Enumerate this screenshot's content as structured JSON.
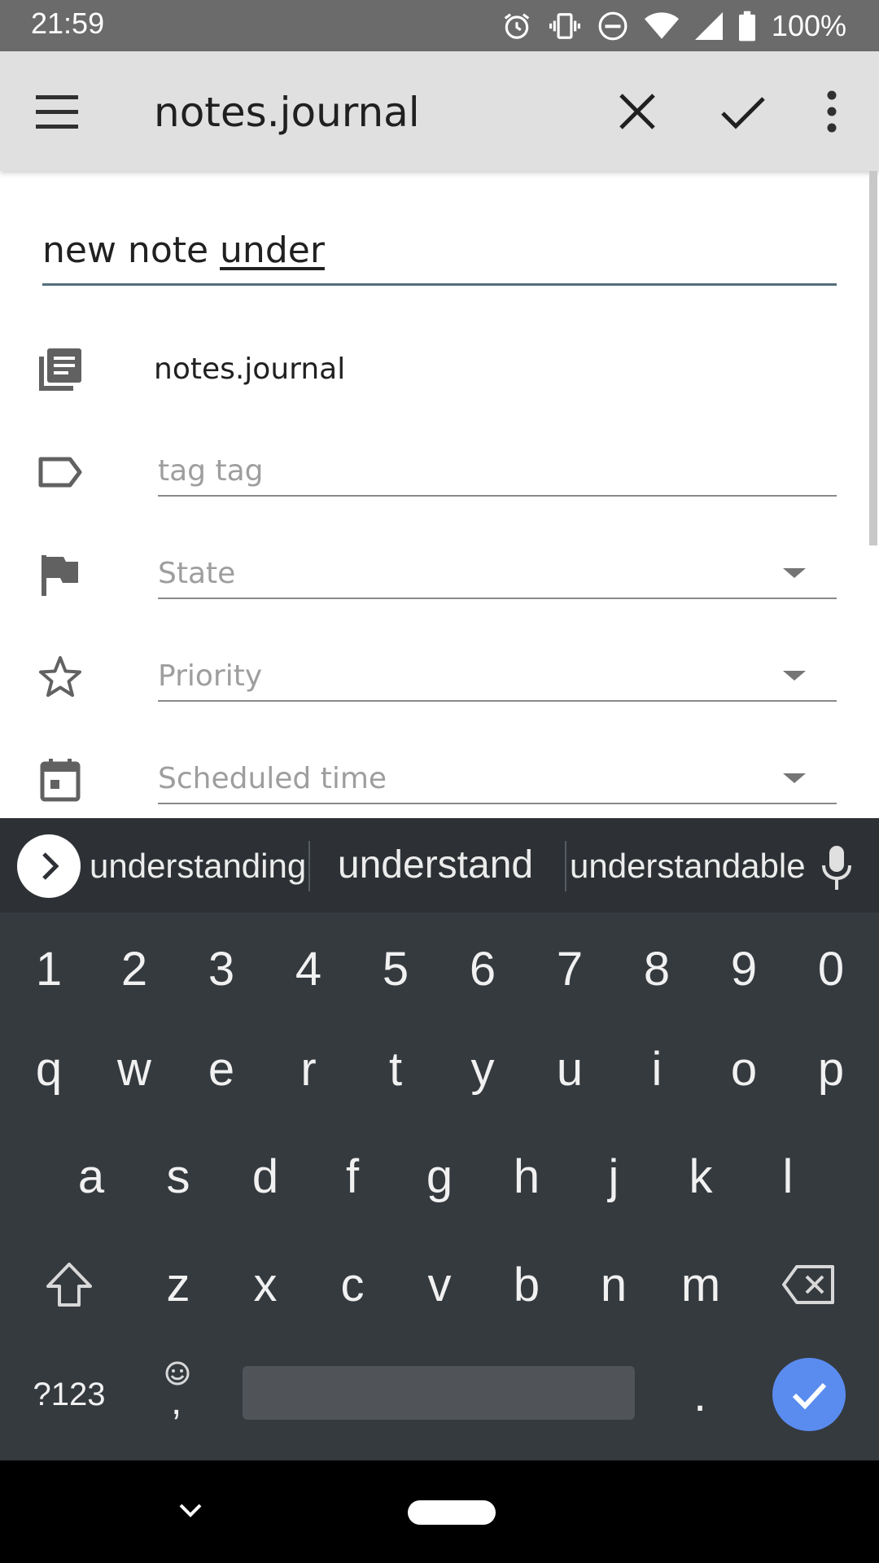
{
  "status_bar": {
    "time": "21:59",
    "battery": "100%"
  },
  "app_bar": {
    "title": "notes.journal"
  },
  "note": {
    "title_plain": "new note ",
    "title_underlined": "under",
    "book": "notes.journal",
    "tags_value": "tag tag",
    "state_placeholder": "State",
    "priority_placeholder": "Priority",
    "scheduled_placeholder": "Scheduled time"
  },
  "keyboard": {
    "suggestions": [
      "understanding",
      "understand",
      "understandable"
    ],
    "row_numbers": [
      "1",
      "2",
      "3",
      "4",
      "5",
      "6",
      "7",
      "8",
      "9",
      "0"
    ],
    "row1": [
      "q",
      "w",
      "e",
      "r",
      "t",
      "y",
      "u",
      "i",
      "o",
      "p"
    ],
    "row2": [
      "a",
      "s",
      "d",
      "f",
      "g",
      "h",
      "j",
      "k",
      "l"
    ],
    "row3": [
      "z",
      "x",
      "c",
      "v",
      "b",
      "n",
      "m"
    ],
    "symbols_key": "?123",
    "comma_key": ",",
    "period_key": "."
  },
  "colors": {
    "app_bar": "#e0e0e0",
    "keyboard_bg": "#353a3f",
    "enter_key": "#5a8cf0",
    "input_underline": "#546e7a"
  }
}
